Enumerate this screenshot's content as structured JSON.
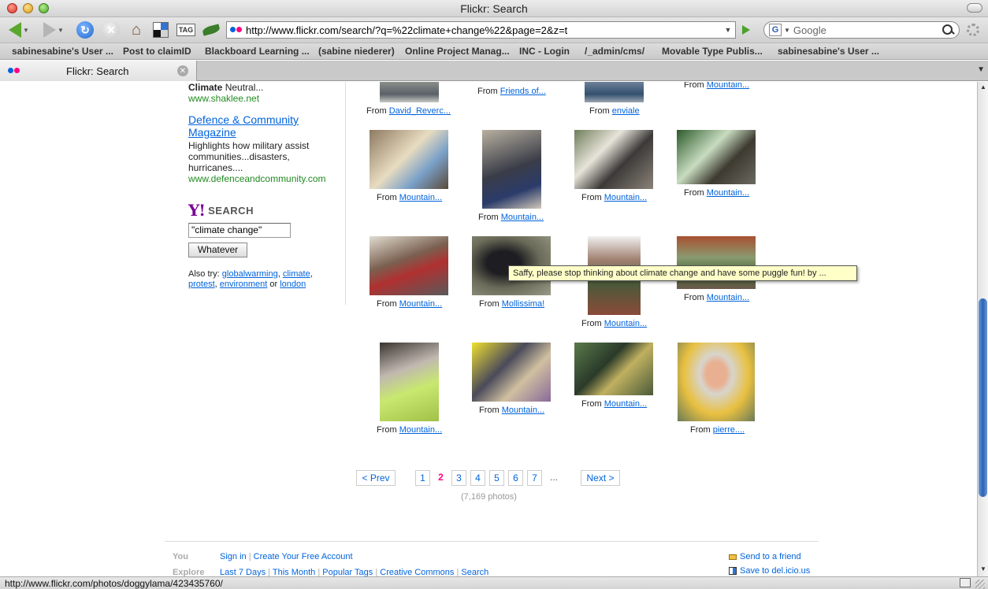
{
  "window": {
    "title": "Flickr: Search"
  },
  "toolbar": {
    "url": "http://www.flickr.com/search/?q=%22climate+change%22&page=2&z=t",
    "search_placeholder": "Google",
    "tag_label": "TAG",
    "search_engine_letter": "G"
  },
  "bookmarks": [
    "sabinesabine's User ...",
    "Post to claimID",
    "Blackboard Learning ...",
    "(sabine niederer)",
    "Online Project Manag...",
    "INC - Login",
    "/_admin/cms/",
    "Movable Type Publis...",
    "sabinesabine's User ..."
  ],
  "tab": {
    "title": "Flickr: Search"
  },
  "sidebar": {
    "ad1": {
      "bold": "Climate",
      "rest": " Neutral...",
      "url": "www.shaklee.net"
    },
    "ad2": {
      "title": "Defence & Community Magazine",
      "desc": "Highlights how military assist communities...disasters, hurricanes....",
      "url": "www.defenceandcommunity.com"
    },
    "yahoo": {
      "logo": "Y!",
      "label": "SEARCH"
    },
    "search_value": "\"climate change\"",
    "search_button": "Whatever",
    "also_try": {
      "prefix": "Also try: ",
      "links": [
        "globalwarming",
        "climate",
        "protest",
        "environment",
        "london"
      ],
      "or": " or "
    }
  },
  "photos": {
    "from_label": "From ",
    "row0": [
      "David_Reverc...",
      "Friends of...",
      "enviale",
      "Mountain..."
    ],
    "row1": [
      "Mountain...",
      "Mountain...",
      "Mountain...",
      "Mountain..."
    ],
    "row2": [
      "Mountain...",
      "Mollissima!",
      "Mountain...",
      "Mountain..."
    ],
    "row3": [
      "Mountain...",
      "Mountain...",
      "Mountain...",
      "pierre...."
    ]
  },
  "tooltip": "Saffy, please stop thinking about climate change and have some puggle fun! by ...",
  "pagination": {
    "prev": "< Prev",
    "pages": [
      "1",
      "2",
      "3",
      "4",
      "5",
      "6",
      "7"
    ],
    "current": "2",
    "ellipsis": "...",
    "next": "Next >",
    "count": "(7,169 photos)"
  },
  "footer": {
    "you_label": "You",
    "you_links": [
      "Sign in",
      "Create Your Free Account"
    ],
    "explore_label": "Explore",
    "explore_links": [
      "Last 7 Days",
      "This Month",
      "Popular Tags",
      "Creative Commons",
      "Search"
    ],
    "send_friend": "Send to a friend",
    "save_delicious": "Save to del.icio.us"
  },
  "status": {
    "text": "http://www.flickr.com/photos/doggylama/423435760/"
  },
  "colors": {
    "flickr_blue": "#0063dc",
    "flickr_pink": "#ff0084",
    "ad_green": "#228b22",
    "yahoo_purple": "#7b0099"
  }
}
